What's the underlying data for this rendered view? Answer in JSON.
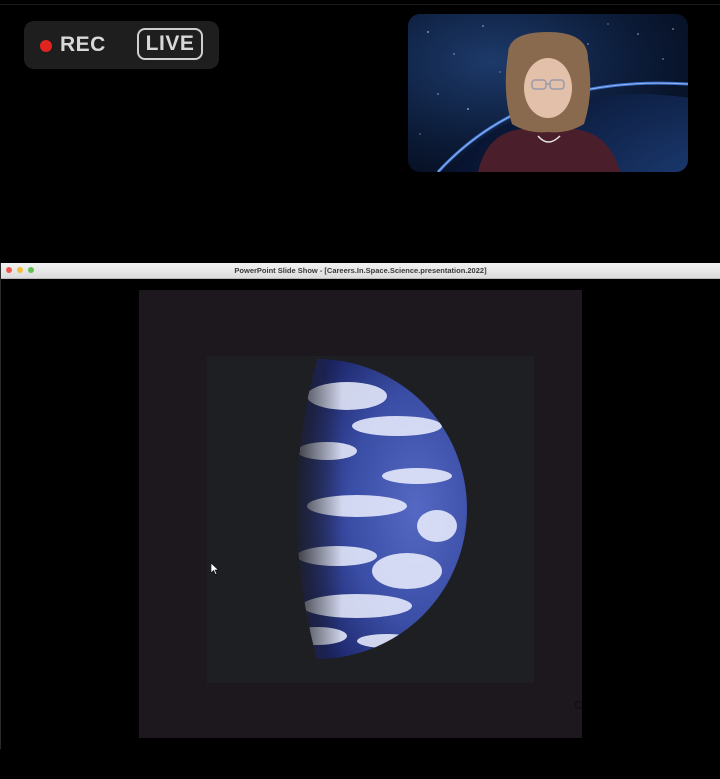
{
  "recording": {
    "rec_label": "REC",
    "live_label": "LIVE",
    "rec_dot_color": "#e0241f"
  },
  "webcam": {
    "icon": "presenter-video"
  },
  "presentation_window": {
    "title": "PowerPoint Slide Show - [Careers.In.Space.Science.presentation.2022]",
    "controls": [
      "close",
      "minimize",
      "zoom"
    ],
    "slide": {
      "image": "earth-half-lit"
    }
  },
  "colors": {
    "background": "#000000",
    "slide_bg": "#1c181d",
    "ocean": "#3a4fa8"
  }
}
